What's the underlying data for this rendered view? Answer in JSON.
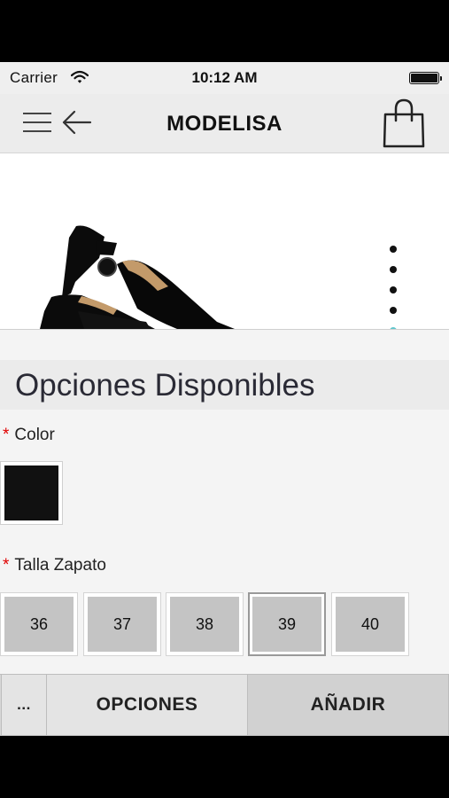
{
  "status_bar": {
    "carrier": "Carrier",
    "time": "10:12 AM"
  },
  "nav": {
    "brand": "MODELISA",
    "icons": [
      "menu-icon",
      "back-arrow-icon",
      "shopping-bag-icon"
    ]
  },
  "product": {
    "image": "black-slingback-shoe",
    "carousel_dots": 5,
    "active_dot_color": "#5fc6cc"
  },
  "options": {
    "title": "Opciones Disponibles",
    "color": {
      "required_mark": "*",
      "label": "Color",
      "swatch_color": "#111111"
    },
    "size": {
      "required_mark": "*",
      "label": "Talla Zapato",
      "values": [
        "36",
        "37",
        "38",
        "39",
        "40"
      ],
      "selected": "39"
    }
  },
  "bottom_bar": {
    "more": "...",
    "options": "OPCIONES",
    "add": "AÑADIR"
  }
}
